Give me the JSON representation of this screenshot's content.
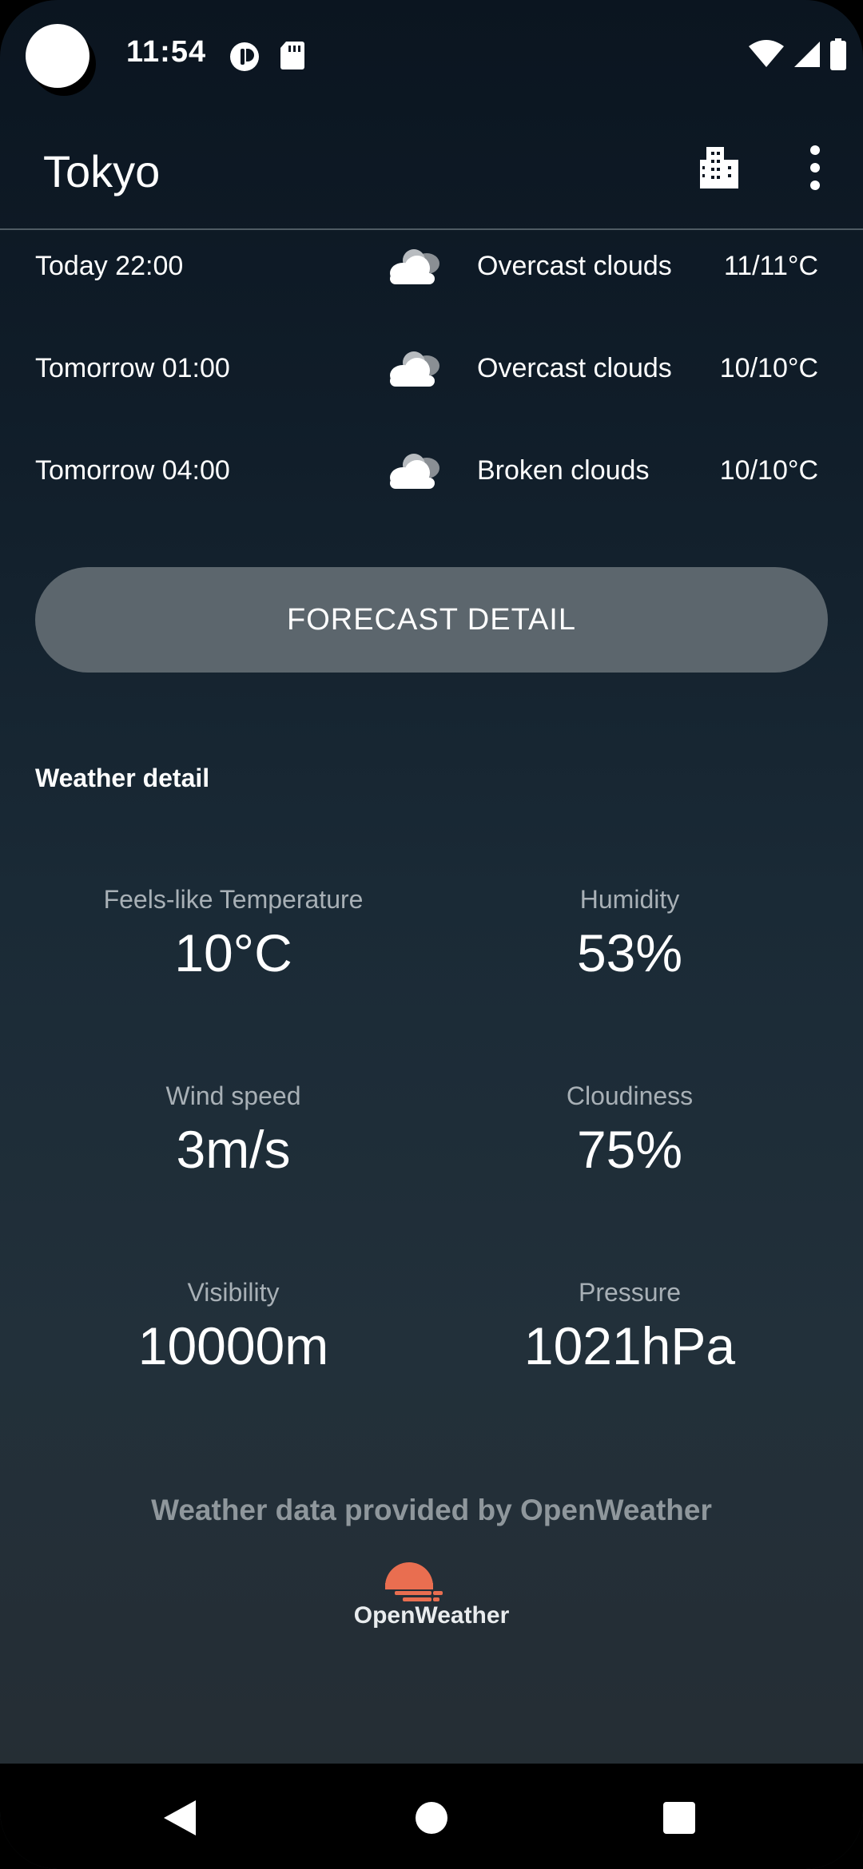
{
  "status_bar": {
    "time": "11:54",
    "icons": [
      "app-notification-icon",
      "sd-card-icon",
      "wifi-icon",
      "cell-signal-icon",
      "battery-icon"
    ]
  },
  "app_bar": {
    "title": "Tokyo",
    "actions": [
      "city-icon",
      "more-vert-icon"
    ]
  },
  "forecast": [
    {
      "time": "Today 22:00",
      "icon": "cloud-icon",
      "description": "Overcast clouds",
      "temp": "11/11°C"
    },
    {
      "time": "Tomorrow 01:00",
      "icon": "cloud-icon",
      "description": "Overcast clouds",
      "temp": "10/10°C"
    },
    {
      "time": "Tomorrow 04:00",
      "icon": "cloud-icon",
      "description": "Broken clouds",
      "temp": "10/10°C"
    }
  ],
  "forecast_button_label": "FORECAST DETAIL",
  "weather_detail": {
    "title": "Weather detail",
    "items": [
      {
        "label": "Feels-like Temperature",
        "value": "10°C"
      },
      {
        "label": "Humidity",
        "value": "53%"
      },
      {
        "label": "Wind speed",
        "value": "3m/s"
      },
      {
        "label": "Cloudiness",
        "value": "75%"
      },
      {
        "label": "Visibility",
        "value": "10000m"
      },
      {
        "label": "Pressure",
        "value": "1021hPa"
      }
    ]
  },
  "attribution": {
    "text": "Weather data provided by OpenWeather",
    "logo_text": "OpenWeather",
    "logo_color": "#e96e50"
  },
  "colors": {
    "background_top": "#0b1520",
    "background_bottom": "#262d33",
    "button": "#5c666d",
    "label_gray": "#a8b0b6"
  }
}
